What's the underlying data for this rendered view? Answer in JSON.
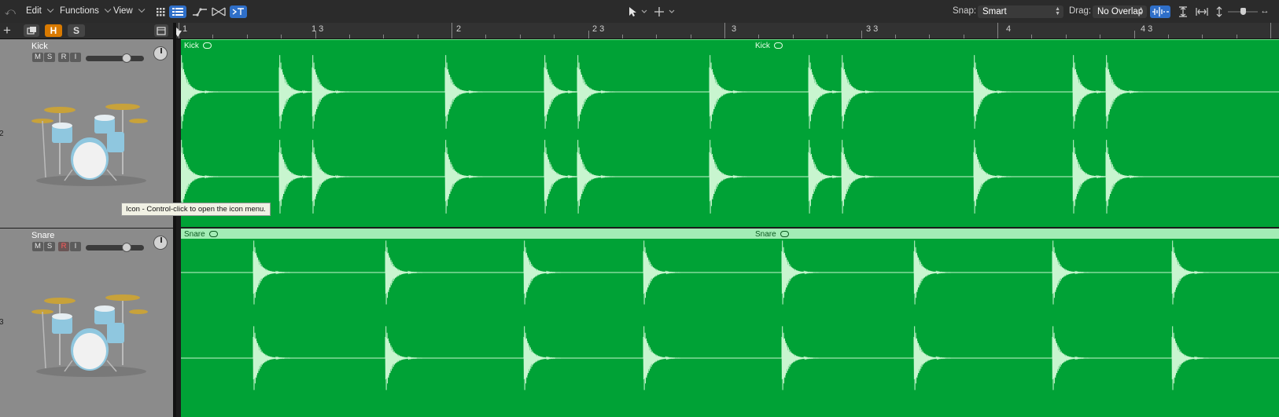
{
  "toolbar": {
    "menus": [
      {
        "label": "Edit"
      },
      {
        "label": "Functions"
      },
      {
        "label": "View"
      }
    ],
    "snap_label": "Snap:",
    "snap_value": "Smart",
    "drag_label": "Drag:",
    "drag_value": "No Overlap",
    "accent_color": "#2f6fc8"
  },
  "track_header_bar": {
    "h_label": "H",
    "s_label": "S",
    "h_color": "#d97a00"
  },
  "ruler": {
    "labels": [
      "1",
      "1 3",
      "2",
      "2 3",
      "3",
      "3 3",
      "4",
      "4 3"
    ]
  },
  "tracks": [
    {
      "number": "2",
      "name": "Kick",
      "buttons": {
        "m": "M",
        "s": "S",
        "r": "R",
        "i": "I"
      },
      "record_enabled": false,
      "volume_level": 0.7,
      "icon": "drum-kit-icon",
      "region_labels": [
        "Kick",
        "Kick"
      ]
    },
    {
      "number": "3",
      "name": "Snare",
      "buttons": {
        "m": "M",
        "s": "S",
        "r": "R",
        "i": "I"
      },
      "record_enabled": true,
      "volume_level": 0.7,
      "icon": "drum-kit-icon",
      "region_labels": [
        "Snare",
        "Snare"
      ]
    }
  ],
  "tooltip": {
    "text": "Icon - Control-click to open the icon menu."
  },
  "colors": {
    "region_green": "#00a236",
    "waveform": "#c8f5cf",
    "header_gray": "#8b8b8b"
  }
}
